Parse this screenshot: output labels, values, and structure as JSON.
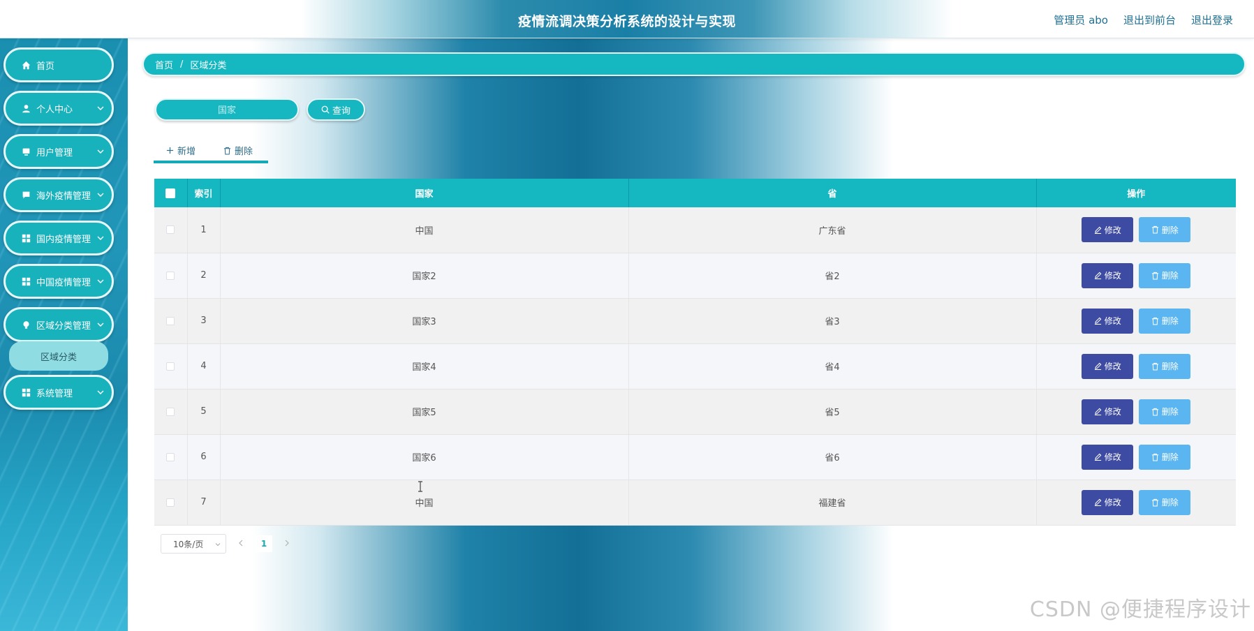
{
  "header": {
    "title": "疫情流调决策分析系统的设计与实现",
    "admin_label": "管理员 abo",
    "back_to_front": "退出到前台",
    "logout": "退出登录"
  },
  "sidebar": {
    "items": [
      {
        "label": "首页",
        "icon": "home-icon"
      },
      {
        "label": "个人中心",
        "icon": "user-icon"
      },
      {
        "label": "用户管理",
        "icon": "monitor-icon"
      },
      {
        "label": "海外疫情管理",
        "icon": "chat-icon"
      },
      {
        "label": "国内疫情管理",
        "icon": "grid-icon"
      },
      {
        "label": "中国疫情管理",
        "icon": "grid-icon"
      },
      {
        "label": "区域分类管理",
        "icon": "bulb-icon"
      },
      {
        "label": "系统管理",
        "icon": "grid-icon"
      }
    ],
    "active_sub": "区域分类"
  },
  "breadcrumb": {
    "home": "首页",
    "separator": "/",
    "current": "区域分类"
  },
  "search": {
    "placeholder": "国家",
    "button": "查询"
  },
  "actions": {
    "add": "新增",
    "delete": "删除"
  },
  "table": {
    "headers": {
      "index": "索引",
      "country": "国家",
      "province": "省",
      "ops": "操作"
    },
    "rows": [
      {
        "index": "1",
        "country": "中国",
        "province": "广东省"
      },
      {
        "index": "2",
        "country": "国家2",
        "province": "省2"
      },
      {
        "index": "3",
        "country": "国家3",
        "province": "省3"
      },
      {
        "index": "4",
        "country": "国家4",
        "province": "省4"
      },
      {
        "index": "5",
        "country": "国家5",
        "province": "省5"
      },
      {
        "index": "6",
        "country": "国家6",
        "province": "省6"
      },
      {
        "index": "7",
        "country": "中国",
        "province": "福建省"
      }
    ],
    "edit_label": "修改",
    "delete_label": "删除"
  },
  "pagination": {
    "page_size": "10条/页",
    "current_page": "1"
  },
  "watermark": "CSDN @便捷程序设计",
  "colors": {
    "accent": "#15b7c1",
    "edit_button": "#3e4ba3",
    "delete_button": "#5ab5f1"
  }
}
